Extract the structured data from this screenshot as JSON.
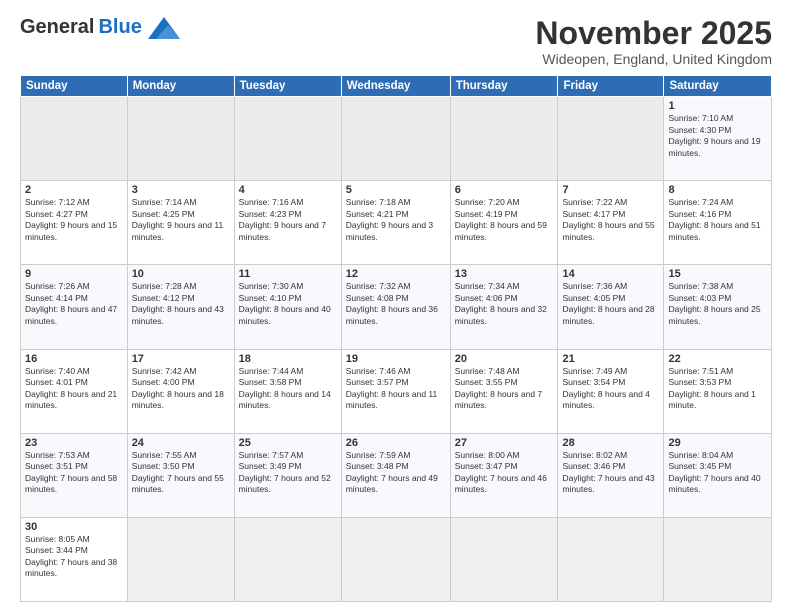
{
  "logo": {
    "general": "General",
    "blue": "Blue"
  },
  "header": {
    "month": "November 2025",
    "location": "Wideopen, England, United Kingdom"
  },
  "days_of_week": [
    "Sunday",
    "Monday",
    "Tuesday",
    "Wednesday",
    "Thursday",
    "Friday",
    "Saturday"
  ],
  "weeks": [
    [
      {
        "day": "",
        "info": ""
      },
      {
        "day": "",
        "info": ""
      },
      {
        "day": "",
        "info": ""
      },
      {
        "day": "",
        "info": ""
      },
      {
        "day": "",
        "info": ""
      },
      {
        "day": "",
        "info": ""
      },
      {
        "day": "1",
        "info": "Sunrise: 7:10 AM\nSunset: 4:30 PM\nDaylight: 9 hours and 19 minutes."
      }
    ],
    [
      {
        "day": "2",
        "info": "Sunrise: 7:12 AM\nSunset: 4:27 PM\nDaylight: 9 hours and 15 minutes."
      },
      {
        "day": "3",
        "info": "Sunrise: 7:14 AM\nSunset: 4:25 PM\nDaylight: 9 hours and 11 minutes."
      },
      {
        "day": "4",
        "info": "Sunrise: 7:16 AM\nSunset: 4:23 PM\nDaylight: 9 hours and 7 minutes."
      },
      {
        "day": "5",
        "info": "Sunrise: 7:18 AM\nSunset: 4:21 PM\nDaylight: 9 hours and 3 minutes."
      },
      {
        "day": "6",
        "info": "Sunrise: 7:20 AM\nSunset: 4:19 PM\nDaylight: 8 hours and 59 minutes."
      },
      {
        "day": "7",
        "info": "Sunrise: 7:22 AM\nSunset: 4:17 PM\nDaylight: 8 hours and 55 minutes."
      },
      {
        "day": "8",
        "info": "Sunrise: 7:24 AM\nSunset: 4:16 PM\nDaylight: 8 hours and 51 minutes."
      }
    ],
    [
      {
        "day": "9",
        "info": "Sunrise: 7:26 AM\nSunset: 4:14 PM\nDaylight: 8 hours and 47 minutes."
      },
      {
        "day": "10",
        "info": "Sunrise: 7:28 AM\nSunset: 4:12 PM\nDaylight: 8 hours and 43 minutes."
      },
      {
        "day": "11",
        "info": "Sunrise: 7:30 AM\nSunset: 4:10 PM\nDaylight: 8 hours and 40 minutes."
      },
      {
        "day": "12",
        "info": "Sunrise: 7:32 AM\nSunset: 4:08 PM\nDaylight: 8 hours and 36 minutes."
      },
      {
        "day": "13",
        "info": "Sunrise: 7:34 AM\nSunset: 4:06 PM\nDaylight: 8 hours and 32 minutes."
      },
      {
        "day": "14",
        "info": "Sunrise: 7:36 AM\nSunset: 4:05 PM\nDaylight: 8 hours and 28 minutes."
      },
      {
        "day": "15",
        "info": "Sunrise: 7:38 AM\nSunset: 4:03 PM\nDaylight: 8 hours and 25 minutes."
      }
    ],
    [
      {
        "day": "16",
        "info": "Sunrise: 7:40 AM\nSunset: 4:01 PM\nDaylight: 8 hours and 21 minutes."
      },
      {
        "day": "17",
        "info": "Sunrise: 7:42 AM\nSunset: 4:00 PM\nDaylight: 8 hours and 18 minutes."
      },
      {
        "day": "18",
        "info": "Sunrise: 7:44 AM\nSunset: 3:58 PM\nDaylight: 8 hours and 14 minutes."
      },
      {
        "day": "19",
        "info": "Sunrise: 7:46 AM\nSunset: 3:57 PM\nDaylight: 8 hours and 11 minutes."
      },
      {
        "day": "20",
        "info": "Sunrise: 7:48 AM\nSunset: 3:55 PM\nDaylight: 8 hours and 7 minutes."
      },
      {
        "day": "21",
        "info": "Sunrise: 7:49 AM\nSunset: 3:54 PM\nDaylight: 8 hours and 4 minutes."
      },
      {
        "day": "22",
        "info": "Sunrise: 7:51 AM\nSunset: 3:53 PM\nDaylight: 8 hours and 1 minute."
      }
    ],
    [
      {
        "day": "23",
        "info": "Sunrise: 7:53 AM\nSunset: 3:51 PM\nDaylight: 7 hours and 58 minutes."
      },
      {
        "day": "24",
        "info": "Sunrise: 7:55 AM\nSunset: 3:50 PM\nDaylight: 7 hours and 55 minutes."
      },
      {
        "day": "25",
        "info": "Sunrise: 7:57 AM\nSunset: 3:49 PM\nDaylight: 7 hours and 52 minutes."
      },
      {
        "day": "26",
        "info": "Sunrise: 7:59 AM\nSunset: 3:48 PM\nDaylight: 7 hours and 49 minutes."
      },
      {
        "day": "27",
        "info": "Sunrise: 8:00 AM\nSunset: 3:47 PM\nDaylight: 7 hours and 46 minutes."
      },
      {
        "day": "28",
        "info": "Sunrise: 8:02 AM\nSunset: 3:46 PM\nDaylight: 7 hours and 43 minutes."
      },
      {
        "day": "29",
        "info": "Sunrise: 8:04 AM\nSunset: 3:45 PM\nDaylight: 7 hours and 40 minutes."
      }
    ],
    [
      {
        "day": "30",
        "info": "Sunrise: 8:05 AM\nSunset: 3:44 PM\nDaylight: 7 hours and 38 minutes."
      },
      {
        "day": "",
        "info": ""
      },
      {
        "day": "",
        "info": ""
      },
      {
        "day": "",
        "info": ""
      },
      {
        "day": "",
        "info": ""
      },
      {
        "day": "",
        "info": ""
      },
      {
        "day": "",
        "info": ""
      }
    ]
  ]
}
